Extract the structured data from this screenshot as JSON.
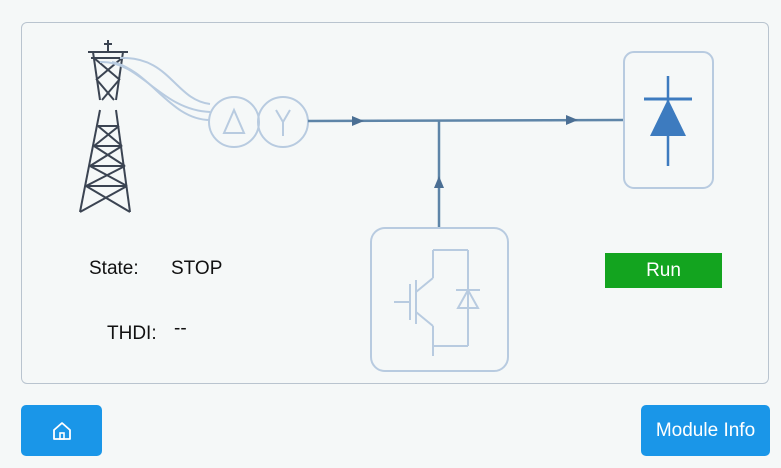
{
  "status": {
    "state_label": "State:",
    "state_value": "STOP",
    "thdi_label": "THDI:",
    "thdi_value": "--"
  },
  "controls": {
    "run_label": "Run",
    "module_info_label": "Module Info"
  },
  "icons": {
    "home": "home-icon",
    "tower": "transmission-tower-icon",
    "transformer": "transformer-delta-wye-icon",
    "load": "diode-load-icon",
    "filter": "igbt-filter-module-icon"
  },
  "colors": {
    "run_button": "#13a41f",
    "nav_button": "#1a96e8",
    "diagram_line": "#5e85a8",
    "diagram_faint": "#b8cbe0"
  }
}
